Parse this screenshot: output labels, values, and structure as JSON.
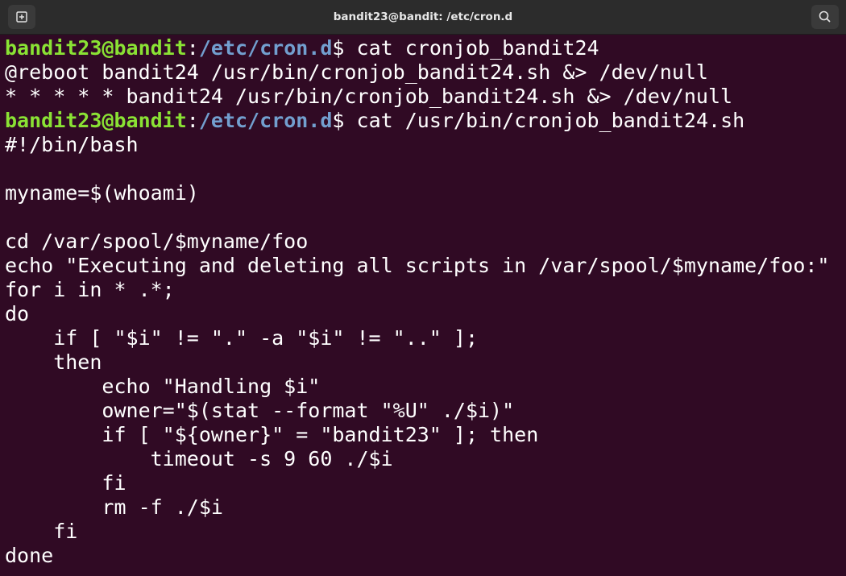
{
  "window": {
    "title": "bandit23@bandit: /etc/cron.d",
    "new_tab_icon": "new-tab-icon",
    "search_icon": "search-icon"
  },
  "colors": {
    "background": "#300a24",
    "prompt_user": "#8ae234",
    "prompt_path": "#729fcf",
    "text": "#ffffff"
  },
  "terminal": {
    "lines": [
      {
        "type": "prompt",
        "user": "bandit23@bandit",
        "sep": ":",
        "path": "/etc/cron.d",
        "cmd": "$ cat cronjob_bandit24"
      },
      {
        "type": "output",
        "text": "@reboot bandit24 /usr/bin/cronjob_bandit24.sh &> /dev/null"
      },
      {
        "type": "output",
        "text": "* * * * * bandit24 /usr/bin/cronjob_bandit24.sh &> /dev/null"
      },
      {
        "type": "prompt",
        "user": "bandit23@bandit",
        "sep": ":",
        "path": "/etc/cron.d",
        "cmd": "$ cat /usr/bin/cronjob_bandit24.sh"
      },
      {
        "type": "output",
        "text": "#!/bin/bash"
      },
      {
        "type": "output",
        "text": ""
      },
      {
        "type": "output",
        "text": "myname=$(whoami)"
      },
      {
        "type": "output",
        "text": ""
      },
      {
        "type": "output",
        "text": "cd /var/spool/$myname/foo"
      },
      {
        "type": "output",
        "text": "echo \"Executing and deleting all scripts in /var/spool/$myname/foo:\""
      },
      {
        "type": "output",
        "text": "for i in * .*;"
      },
      {
        "type": "output",
        "text": "do"
      },
      {
        "type": "output",
        "text": "    if [ \"$i\" != \".\" -a \"$i\" != \"..\" ];"
      },
      {
        "type": "output",
        "text": "    then"
      },
      {
        "type": "output",
        "text": "        echo \"Handling $i\""
      },
      {
        "type": "output",
        "text": "        owner=\"$(stat --format \"%U\" ./$i)\""
      },
      {
        "type": "output",
        "text": "        if [ \"${owner}\" = \"bandit23\" ]; then"
      },
      {
        "type": "output",
        "text": "            timeout -s 9 60 ./$i"
      },
      {
        "type": "output",
        "text": "        fi"
      },
      {
        "type": "output",
        "text": "        rm -f ./$i"
      },
      {
        "type": "output",
        "text": "    fi"
      },
      {
        "type": "output",
        "text": "done"
      }
    ]
  }
}
